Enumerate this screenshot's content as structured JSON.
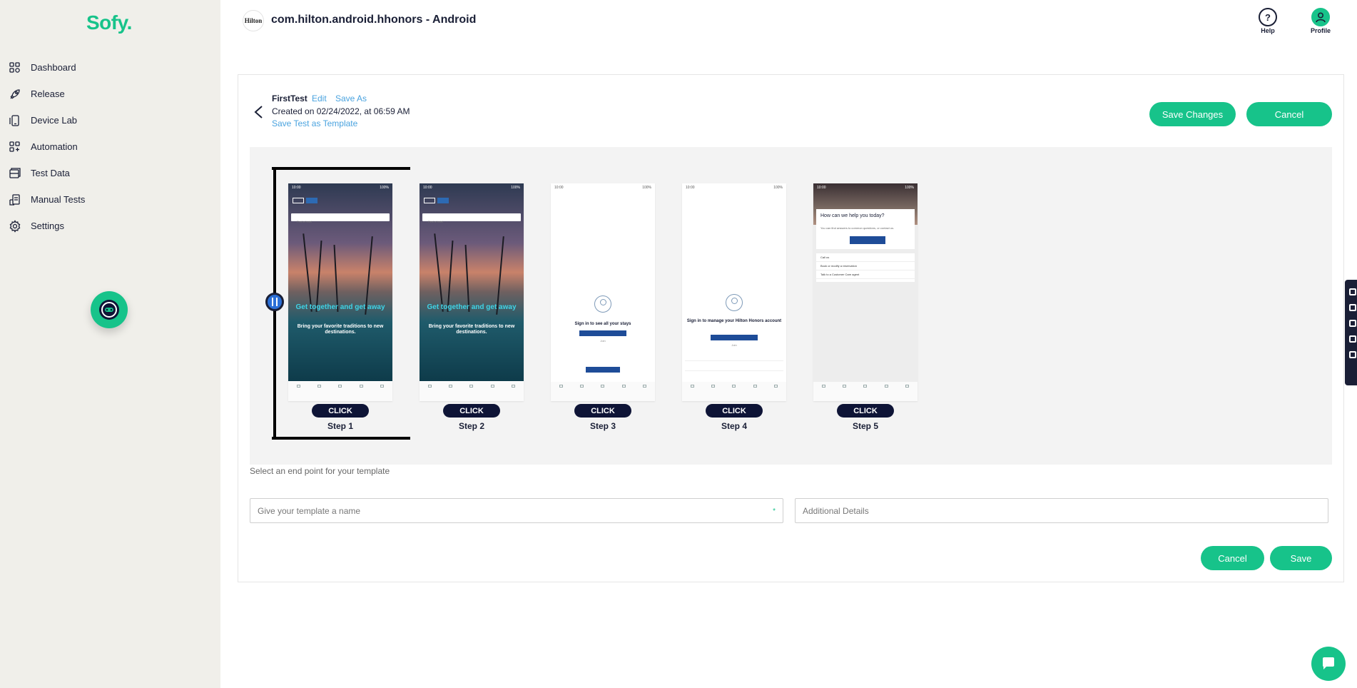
{
  "brand": {
    "logo_text": "Sofy.",
    "accent": "#17c38a",
    "dark": "#1a1f36"
  },
  "sidebar": {
    "items": [
      {
        "label": "Dashboard",
        "icon": "dashboard-icon"
      },
      {
        "label": "Release",
        "icon": "rocket-icon"
      },
      {
        "label": "Device Lab",
        "icon": "device-icon"
      },
      {
        "label": "Automation",
        "icon": "automation-icon"
      },
      {
        "label": "Test Data",
        "icon": "database-icon"
      },
      {
        "label": "Manual Tests",
        "icon": "manual-test-icon"
      },
      {
        "label": "Settings",
        "icon": "gear-icon"
      }
    ]
  },
  "header": {
    "app_logo_text": "Hilton",
    "title": "com.hilton.android.hhonors - Android",
    "help_label": "Help",
    "profile_label": "Profile"
  },
  "test": {
    "name": "FirstTest",
    "edit_label": "Edit",
    "save_as_label": "Save As",
    "created": "Created on 02/24/2022, at 06:59 AM",
    "save_template_label": "Save Test as Template",
    "save_changes_label": "Save Changes",
    "cancel_label": "Cancel"
  },
  "steps": [
    {
      "action": "CLICK",
      "label": "Step 1"
    },
    {
      "action": "CLICK",
      "label": "Step 2"
    },
    {
      "action": "CLICK",
      "label": "Step 3"
    },
    {
      "action": "CLICK",
      "label": "Step 4"
    },
    {
      "action": "CLICK",
      "label": "Step 5"
    }
  ],
  "phone": {
    "search_placeholder": "Find a hotel",
    "hero_title": "Get together and get away",
    "hero_sub": "Bring your favorite traditions to new destinations.",
    "stays_text": "Sign in to see all your stays",
    "account_text": "Sign in to manage your Hilton Honors account",
    "help_title": "How can we help you today?",
    "help_sub": "You can find answers to common questions, or contact us.",
    "call_us": "Call us",
    "list_1": "Book or modify a reservation",
    "list_2": "Talk to a Customer Care agent"
  },
  "template": {
    "hint": "Select an end point for your template",
    "name_placeholder": "Give your template a name",
    "required_mark": "*",
    "details_placeholder": "Additional Details",
    "cancel_label": "Cancel",
    "save_label": "Save"
  }
}
